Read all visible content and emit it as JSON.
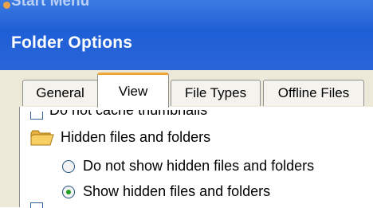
{
  "window": {
    "background_hint": "Start Menu",
    "title": "Folder Options"
  },
  "tabs": [
    {
      "label": "General",
      "active": false
    },
    {
      "label": "View",
      "active": true
    },
    {
      "label": "File Types",
      "active": false
    },
    {
      "label": "Offline Files",
      "active": false
    }
  ],
  "view_settings": {
    "cut_off_item": "Do not cache thumbnails",
    "group": {
      "label": "Hidden files and folders",
      "options": [
        {
          "label": "Do not show hidden files and folders",
          "selected": false
        },
        {
          "label": "Show hidden files and folders",
          "selected": true
        }
      ]
    }
  },
  "colors": {
    "title_bar": "#2a64d8",
    "dialog_bg": "#ece9d8",
    "active_tab_accent": "#f0a43a",
    "radio_selected": "#21a121"
  },
  "icons": {
    "group_icon": "folder-icon",
    "option_control": "radio-button"
  }
}
